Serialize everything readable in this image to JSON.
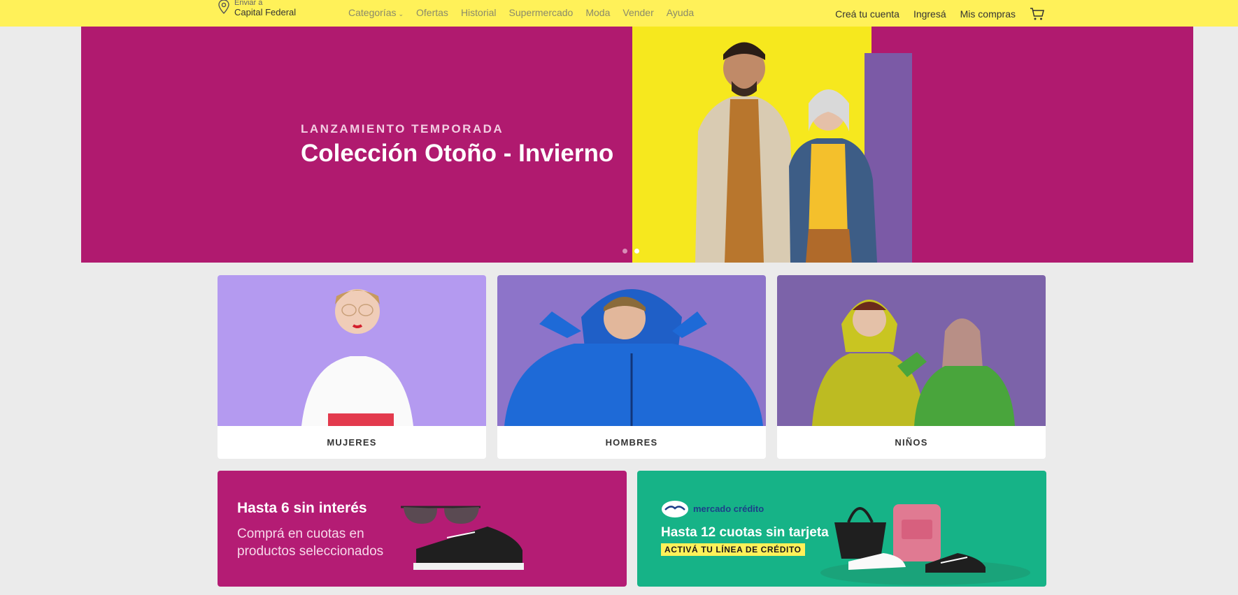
{
  "header": {
    "location_small": "Enviar a",
    "location_big": "Capital Federal",
    "nav": [
      "Categorías",
      "Ofertas",
      "Historial",
      "Supermercado",
      "Moda",
      "Vender",
      "Ayuda"
    ],
    "account": [
      "Creá tu cuenta",
      "Ingresá",
      "Mis compras"
    ],
    "accent": "#fff159"
  },
  "hero": {
    "kicker": "LANZAMIENTO TEMPORADA",
    "title": "Colección Otoño - Invierno",
    "background": "#b01a6f"
  },
  "categories": [
    {
      "label": "MUJERES",
      "bg": "#b49af0"
    },
    {
      "label": "HOMBRES",
      "bg": "#8d74c9"
    },
    {
      "label": "NIÑOS",
      "bg": "#7c63a9"
    }
  ],
  "promos": {
    "cuotas": {
      "title": "Hasta 6 sin interés",
      "subtitle": "Comprá en cuotas en productos seleccionados"
    },
    "credito": {
      "brand": "mercado crédito",
      "title": "Hasta 12 cuotas sin tarjeta",
      "cta": "ACTIVÁ TU LÍNEA DE CRÉDITO"
    }
  }
}
